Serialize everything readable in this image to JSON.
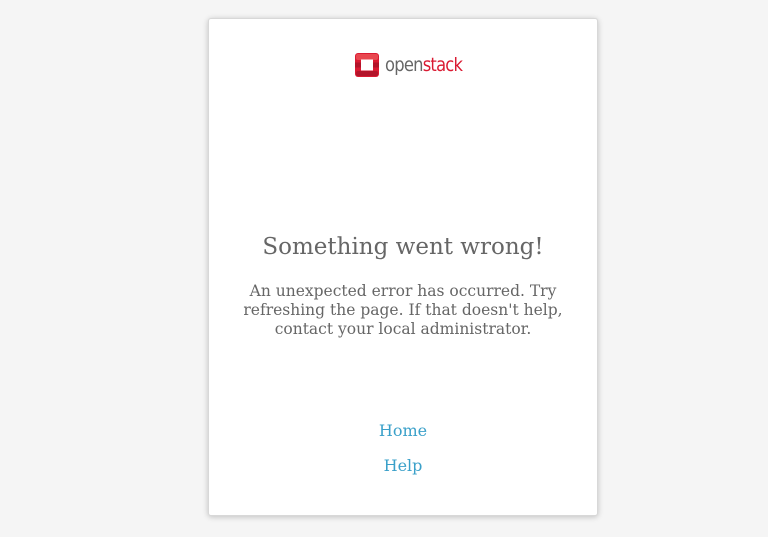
{
  "logo": {
    "icon": "openstack-logo-icon",
    "text_open": "open",
    "text_stack": "stack",
    "brand_color": "#da1a32",
    "text_color": "#666666"
  },
  "error": {
    "title": "Something went wrong!",
    "message": "An unexpected error has occurred. Try refreshing the page. If that doesn't help, contact your local administrator."
  },
  "links": {
    "home": "Home",
    "help": "Help",
    "color": "#3aa0c9"
  }
}
